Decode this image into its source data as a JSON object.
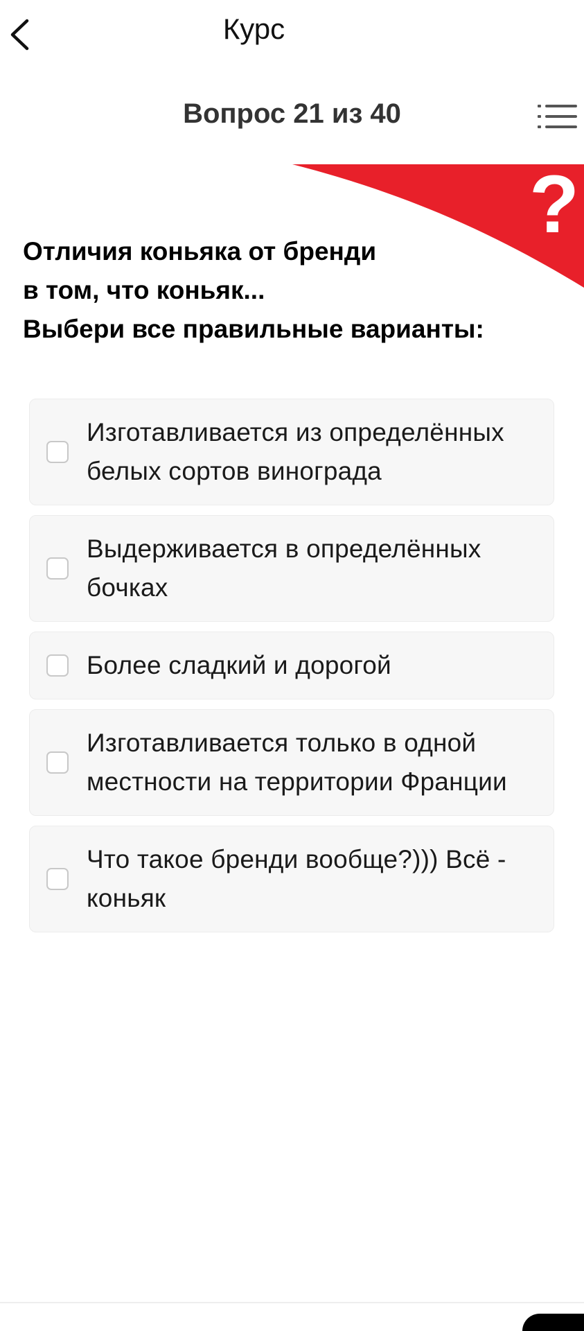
{
  "header": {
    "title": "Курс"
  },
  "quiz": {
    "counter": "Вопрос 21 из 40",
    "question_lines": [
      "Отличия коньяка от бренди",
      "в том, что коньяк...",
      "Выбери все правильные варианты:"
    ],
    "options": [
      {
        "label": "Изготавливается из определённых белых сортов винограда",
        "checked": false
      },
      {
        "label": "Выдерживается в определённых бочках",
        "checked": false
      },
      {
        "label": "Более сладкий и дорогой",
        "checked": false
      },
      {
        "label": "Изготавливается только в одной местности на территории Франции",
        "checked": false
      },
      {
        "label": "Что такое бренди вообще?))) Всё - коньяк",
        "checked": false
      }
    ]
  },
  "icons": {
    "back": "chevron-left-icon",
    "menu": "list-menu-icon",
    "banner": "question-mark-icon"
  },
  "colors": {
    "accent_red": "#e8202a",
    "text_primary": "#111111",
    "counter_text": "#333333",
    "option_background": "#f7f7f7"
  }
}
